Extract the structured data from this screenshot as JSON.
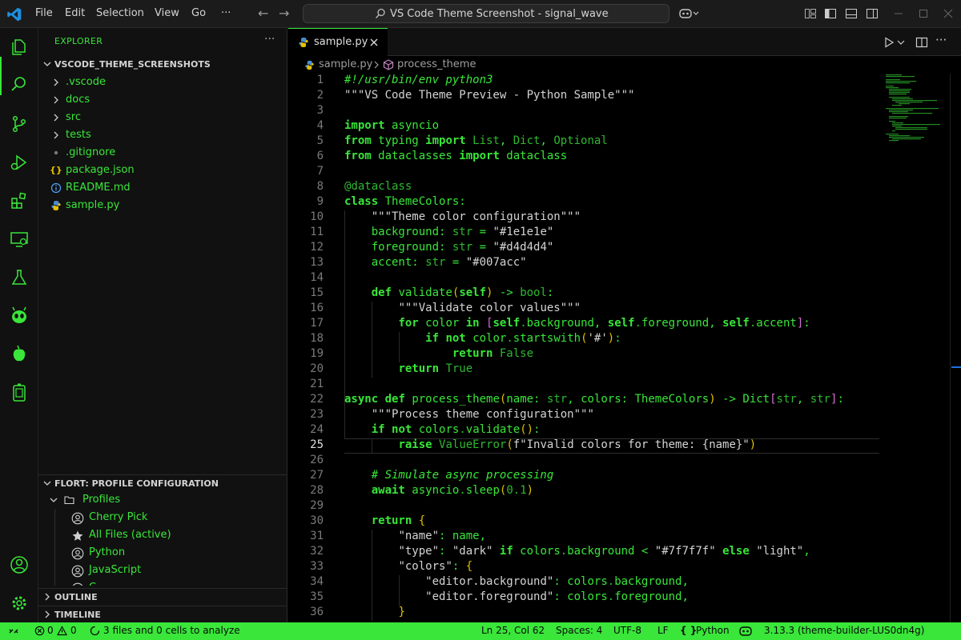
{
  "window": {
    "command_center": "VS Code Theme Screenshot - signal_wave"
  },
  "menu": [
    "File",
    "Edit",
    "Selection",
    "View",
    "Go",
    "···"
  ],
  "sidebar": {
    "title": "EXPLORER",
    "more": "···",
    "workspace": "VSCODE_THEME_SCREENSHOTS",
    "items": [
      {
        "label": ".vscode",
        "kind": "folder"
      },
      {
        "label": "docs",
        "kind": "folder"
      },
      {
        "label": "src",
        "kind": "folder"
      },
      {
        "label": "tests",
        "kind": "folder"
      },
      {
        "label": ".gitignore",
        "kind": "git"
      },
      {
        "label": "package.json",
        "kind": "json",
        "icon_text": "{}"
      },
      {
        "label": "README.md",
        "kind": "info"
      },
      {
        "label": "sample.py",
        "kind": "python"
      }
    ],
    "profile_section": "FLORT: PROFILE CONFIGURATION",
    "profiles_folder": "Profiles",
    "profiles": [
      "Cherry Pick",
      "All Files (active)",
      "Python",
      "JavaScript",
      "C"
    ],
    "outline": "OUTLINE",
    "timeline": "TIMELINE"
  },
  "editor": {
    "tab_label": "sample.py",
    "breadcrumb": {
      "file": "sample.py",
      "symbol": "process_theme"
    },
    "current_line": 25
  },
  "code_lines": [
    "#!/usr/bin/env python3",
    "\"\"\"VS Code Theme Preview - Python Sample\"\"\"",
    "",
    "import asyncio",
    "from typing import List, Dict, Optional",
    "from dataclasses import dataclass",
    "",
    "@dataclass",
    "class ThemeColors:",
    "    \"\"\"Theme color configuration\"\"\"",
    "    background: str = \"#1e1e1e\"",
    "    foreground: str = \"#d4d4d4\"",
    "    accent: str = \"#007acc\"",
    "",
    "    def validate(self) -> bool:",
    "        \"\"\"Validate color values\"\"\"",
    "        for color in [self.background, self.foreground, self.accent]:",
    "            if not color.startswith('#'):",
    "                return False",
    "        return True",
    "",
    "async def process_theme(name: str, colors: ThemeColors) -> Dict[str, str]:",
    "    \"\"\"Process theme configuration\"\"\"",
    "    if not colors.validate():",
    "        raise ValueError(f\"Invalid colors for theme: {name}\")",
    "",
    "    # Simulate async processing",
    "    await asyncio.sleep(0.1)",
    "",
    "    return {",
    "        \"name\": name,",
    "        \"type\": \"dark\" if colors.background < \"#7f7f7f\" else \"light\",",
    "        \"colors\": {",
    "            \"editor.background\": colors.background,",
    "            \"editor.foreground\": colors.foreground,",
    "        }"
  ],
  "status": {
    "remote": "⟩⟨",
    "errors": "0",
    "warnings": "0",
    "analysis": "3 files and 0 cells to analyze",
    "position": "Ln 25, Col 62",
    "spaces": "Spaces: 4",
    "encoding": "UTF-8",
    "eol": "LF",
    "language_prefix": "{ }",
    "language": "Python",
    "interpreter": "3.13.3 (theme-builder-LUS0dn4g)"
  },
  "colors": {
    "accent": "#39e639",
    "background": "#000000",
    "panel": "#111111",
    "statusbar": "#39e639"
  }
}
